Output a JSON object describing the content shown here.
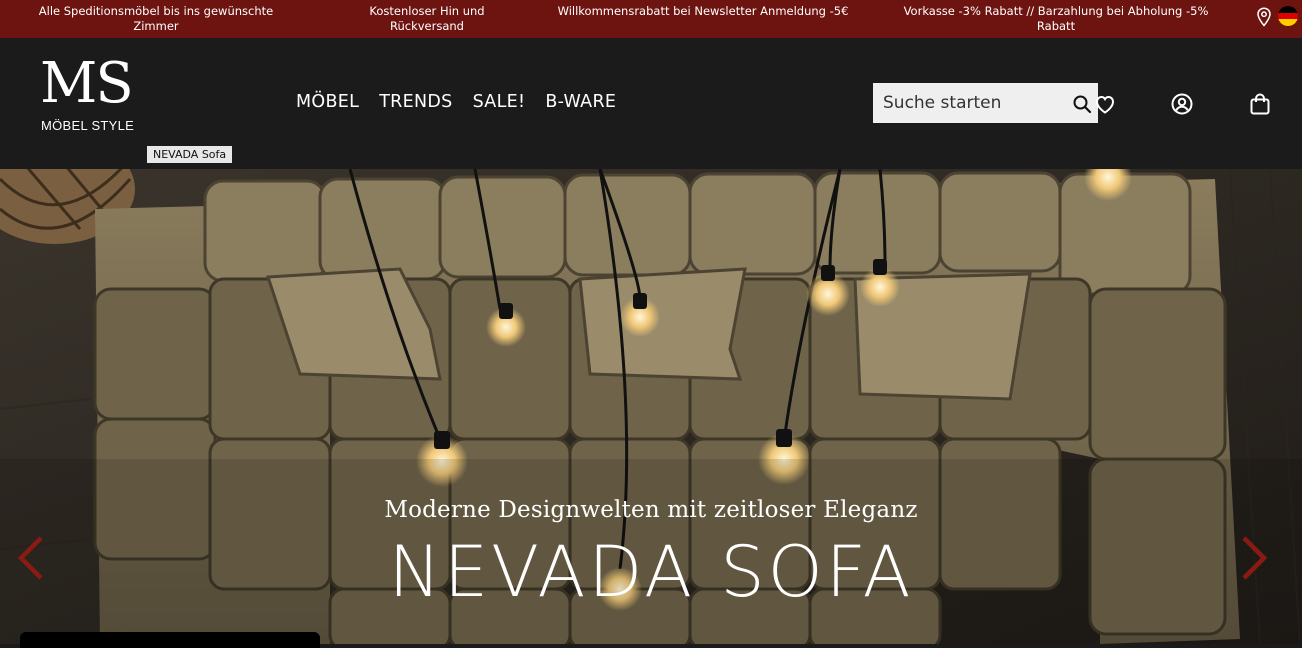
{
  "promo": {
    "items": [
      "Alle Speditionsmöbel bis ins gewünschte Zimmer",
      "Kostenloser Hin und Rückversand",
      "Willkommensrabatt bei Newsletter Anmeldung -5€",
      "Vorkasse -3% Rabatt // Barzahlung bei Abholung -5% Rabatt"
    ],
    "icons": [
      "location-pin-icon",
      "german-flag-icon"
    ]
  },
  "header": {
    "logo_mark": "MS",
    "logo_sub": "MÖBEL STYLE",
    "tooltip": "NEVADA Sofa",
    "nav": [
      "MÖBEL",
      "TRENDS",
      "SALE!",
      "B-WARE"
    ],
    "search": {
      "placeholder": "Suche starten",
      "value": ""
    },
    "icons": [
      "search-icon",
      "heart-icon",
      "user-icon",
      "bag-icon"
    ]
  },
  "hero": {
    "subtitle": "Moderne Designwelten mit zeitloser Eleganz",
    "title": "NEVADA SOFA",
    "arrows": [
      "chevron-left-icon",
      "chevron-right-icon"
    ],
    "accent_color": "#8a1a14"
  }
}
